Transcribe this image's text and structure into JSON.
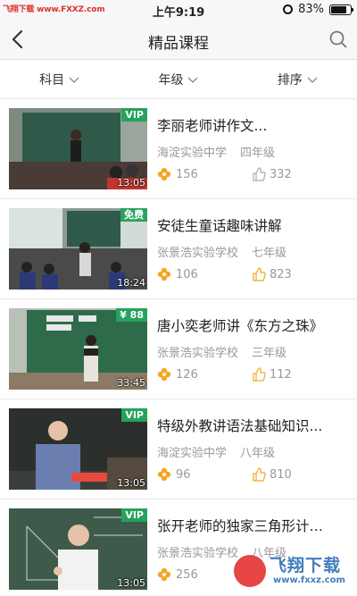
{
  "status_bar": {
    "watermark": "飞翔下载 www.FXXZ.com",
    "time": "上午9:19",
    "battery_percent": "83%",
    "battery_level": 0.83
  },
  "nav": {
    "title": "精品课程"
  },
  "filters": [
    {
      "label": "科目"
    },
    {
      "label": "年级"
    },
    {
      "label": "排序"
    }
  ],
  "courses": [
    {
      "title": "李丽老师讲作文...",
      "school": "海淀实验中学",
      "grade": "四年级",
      "likes": "156",
      "thumbs": "332",
      "badge": "VIP",
      "duration": "13:05"
    },
    {
      "title": "安徒生童话趣味讲解",
      "school": "张景浩实验学校",
      "grade": "七年级",
      "likes": "106",
      "thumbs": "823",
      "badge": "免费",
      "duration": "18:24"
    },
    {
      "title": "唐小奕老师讲《东方之珠》",
      "school": "张景浩实验学校",
      "grade": "三年级",
      "likes": "126",
      "thumbs": "112",
      "badge": "¥ 88",
      "duration": "33:45"
    },
    {
      "title": "特级外教讲语法基础知识...",
      "school": "海淀实验中学",
      "grade": "八年级",
      "likes": "96",
      "thumbs": "810",
      "badge": "VIP",
      "duration": "13:05"
    },
    {
      "title": "张开老师的独家三角形计算...",
      "school": "张景浩实验学校",
      "grade": "八年级",
      "likes": "256",
      "thumbs": "",
      "badge": "VIP",
      "duration": "13:05"
    }
  ],
  "watermark_logo": {
    "cn": "飞翔下载",
    "en": "www.fxxz.com"
  },
  "colors": {
    "accent_orange": "#f5a623",
    "badge_green": "#24a35a",
    "meta_gray": "#999999"
  }
}
